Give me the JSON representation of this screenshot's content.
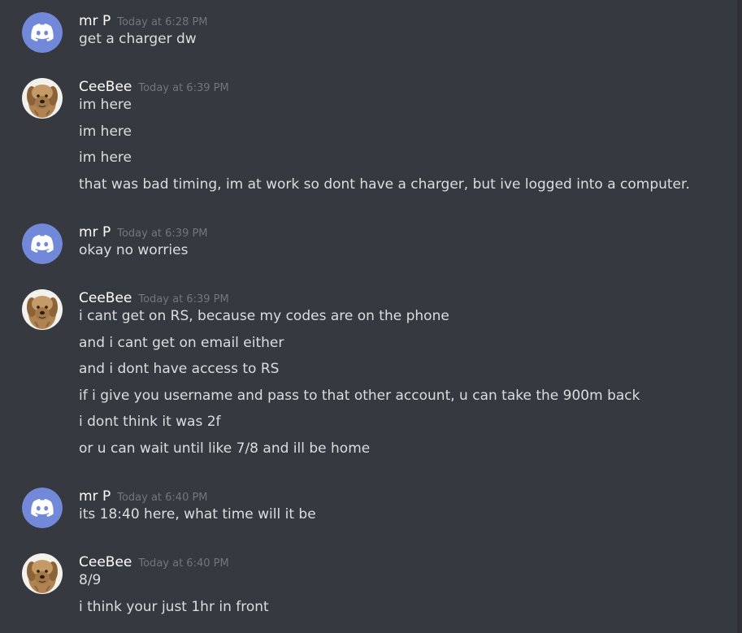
{
  "colors": {
    "background": "#36393f",
    "username": "#ffffff",
    "text": "#dcddde",
    "timestamp": "#72767d",
    "discord_blurple": "#7289da"
  },
  "messages": [
    {
      "author": "mr P",
      "avatar": "discord-logo-icon",
      "timestamp": "Today at 6:28 PM",
      "lines": [
        "get a charger dw"
      ]
    },
    {
      "author": "CeeBee",
      "avatar": "dog-avatar",
      "timestamp": "Today at 6:39 PM",
      "lines": [
        "im here",
        "im here",
        "im here",
        "that was bad timing, im at work so dont have a charger, but ive logged into a computer."
      ]
    },
    {
      "author": "mr P",
      "avatar": "discord-logo-icon",
      "timestamp": "Today at 6:39 PM",
      "lines": [
        "okay no worries"
      ]
    },
    {
      "author": "CeeBee",
      "avatar": "dog-avatar",
      "timestamp": "Today at 6:39 PM",
      "lines": [
        "i cant get on RS, because my codes are on the phone",
        "and i cant get on email either",
        "and i dont have access to RS",
        "if i give you username and pass to that other account, u can take the 900m back",
        "i dont think it was 2f",
        "or u can wait until like 7/8 and ill be home"
      ]
    },
    {
      "author": "mr P",
      "avatar": "discord-logo-icon",
      "timestamp": "Today at 6:40 PM",
      "lines": [
        "its 18:40 here, what time will it be"
      ]
    },
    {
      "author": "CeeBee",
      "avatar": "dog-avatar",
      "timestamp": "Today at 6:40 PM",
      "lines": [
        "8/9",
        "i think your just 1hr in front"
      ]
    }
  ]
}
